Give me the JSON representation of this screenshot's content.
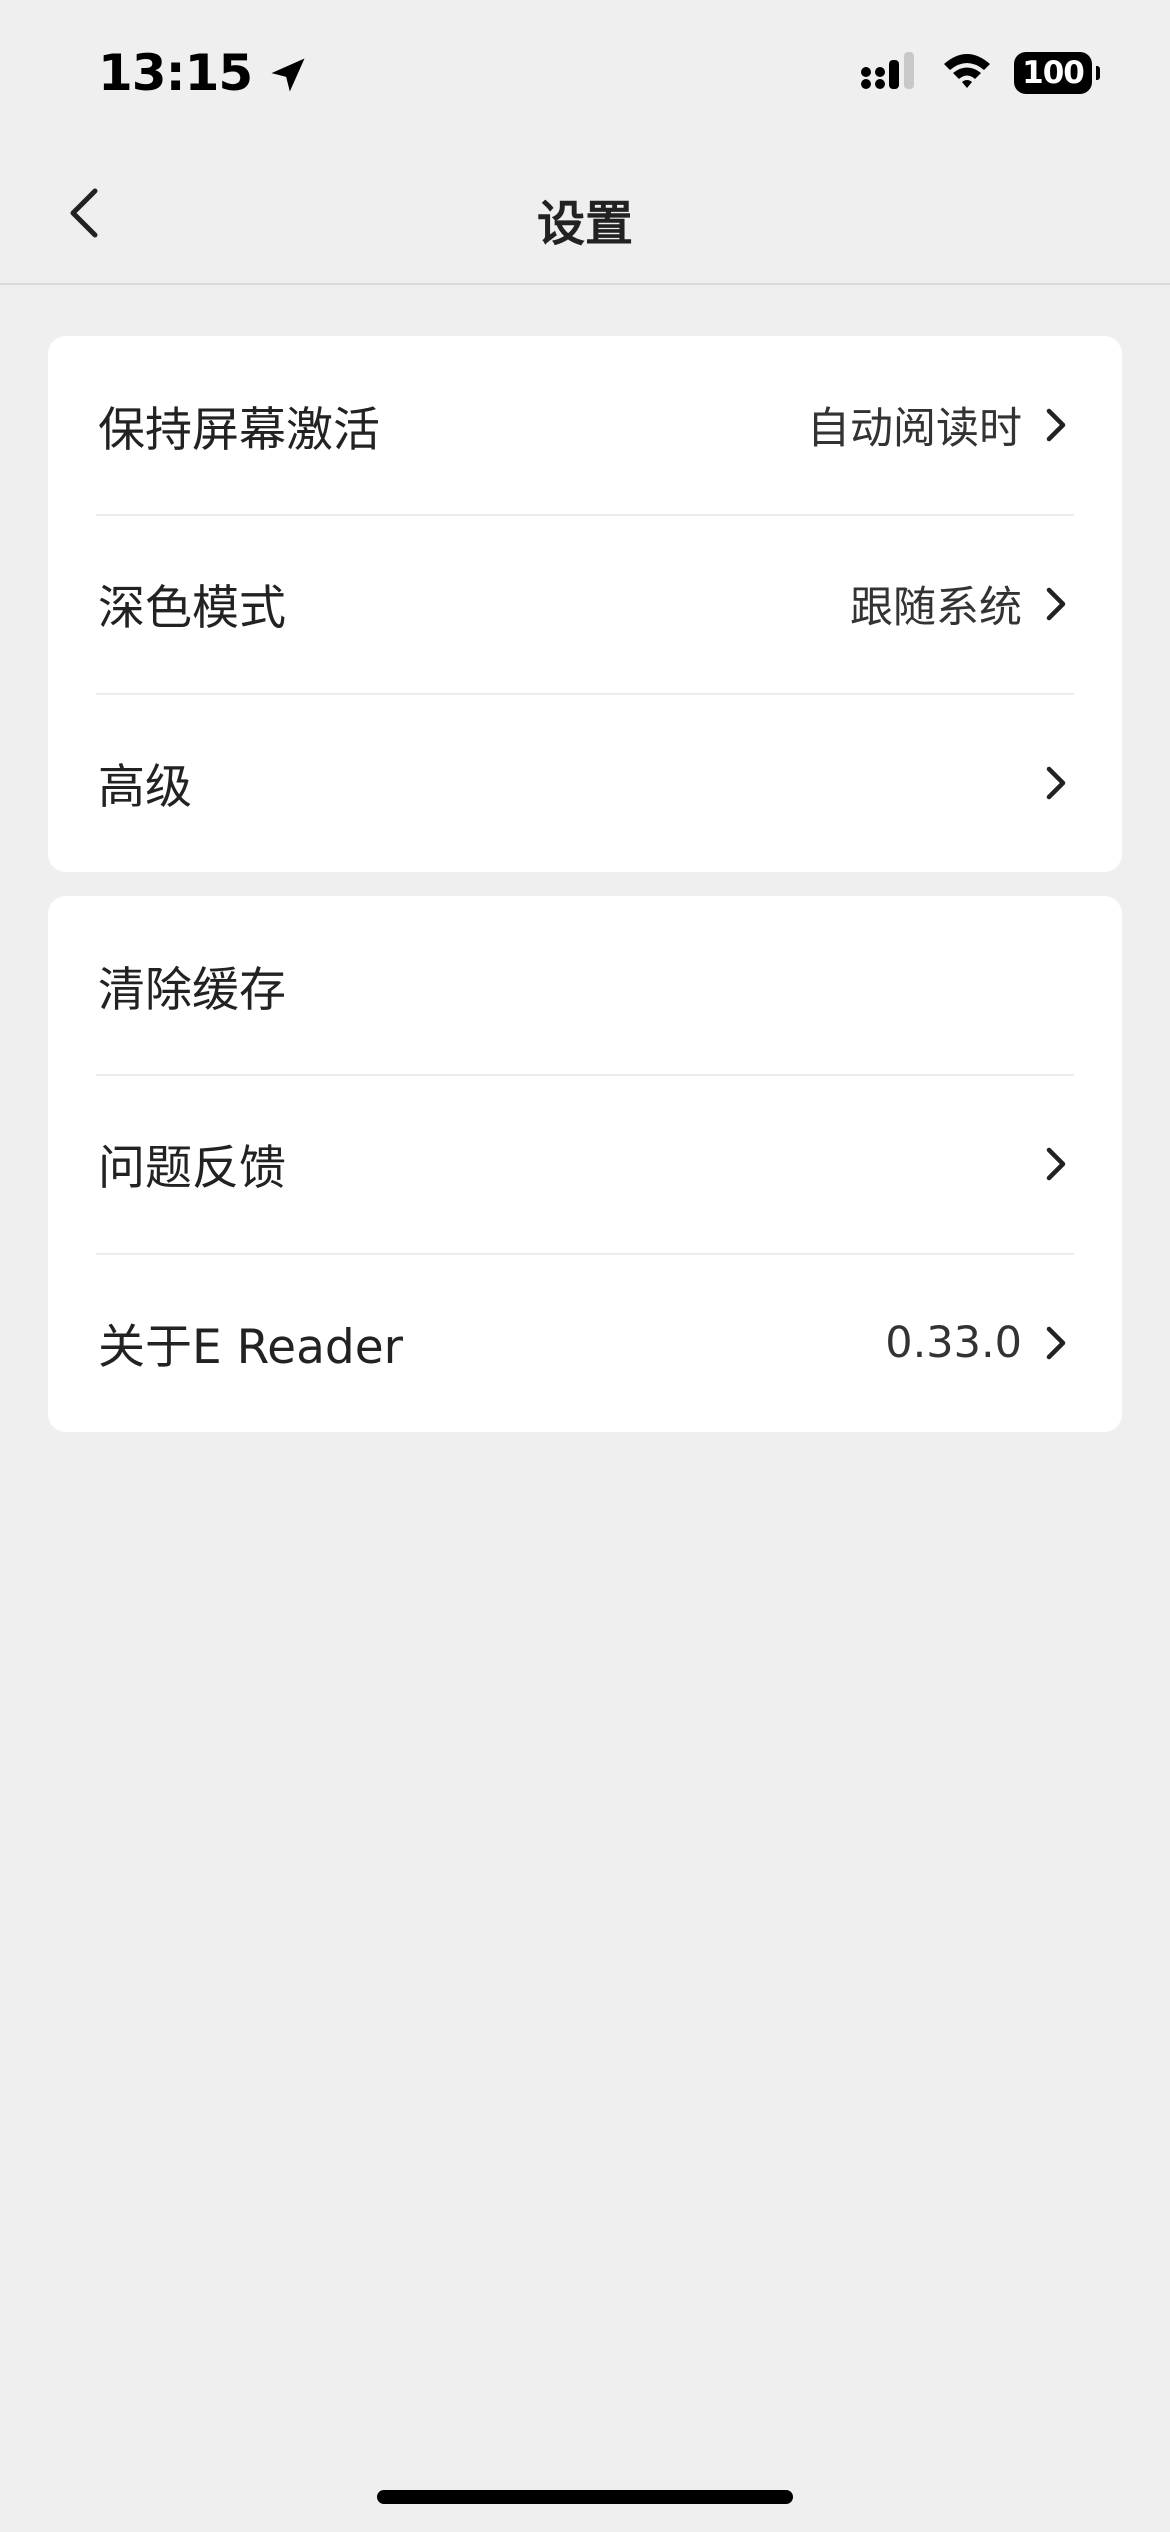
{
  "status_bar": {
    "time": "13:15",
    "battery": "100",
    "icons": [
      "location-arrow-icon",
      "cellular-signal-icon",
      "wifi-icon",
      "battery-icon"
    ]
  },
  "nav": {
    "title": "设置",
    "back_icon": "chevron-left-icon"
  },
  "groups": [
    {
      "items": [
        {
          "label": "保持屏幕激活",
          "value": "自动阅读时",
          "chevron": true
        },
        {
          "label": "深色模式",
          "value": "跟随系统",
          "chevron": true
        },
        {
          "label": "高级",
          "value": "",
          "chevron": true
        }
      ]
    },
    {
      "items": [
        {
          "label": "清除缓存",
          "value": "",
          "chevron": false
        },
        {
          "label": "问题反馈",
          "value": "",
          "chevron": true
        },
        {
          "label": "关于E Reader",
          "value": "0.33.0",
          "chevron": true
        }
      ]
    }
  ],
  "colors": {
    "background": "#efefef",
    "card": "#ffffff",
    "text": "#222222",
    "divider": "#ececec"
  }
}
